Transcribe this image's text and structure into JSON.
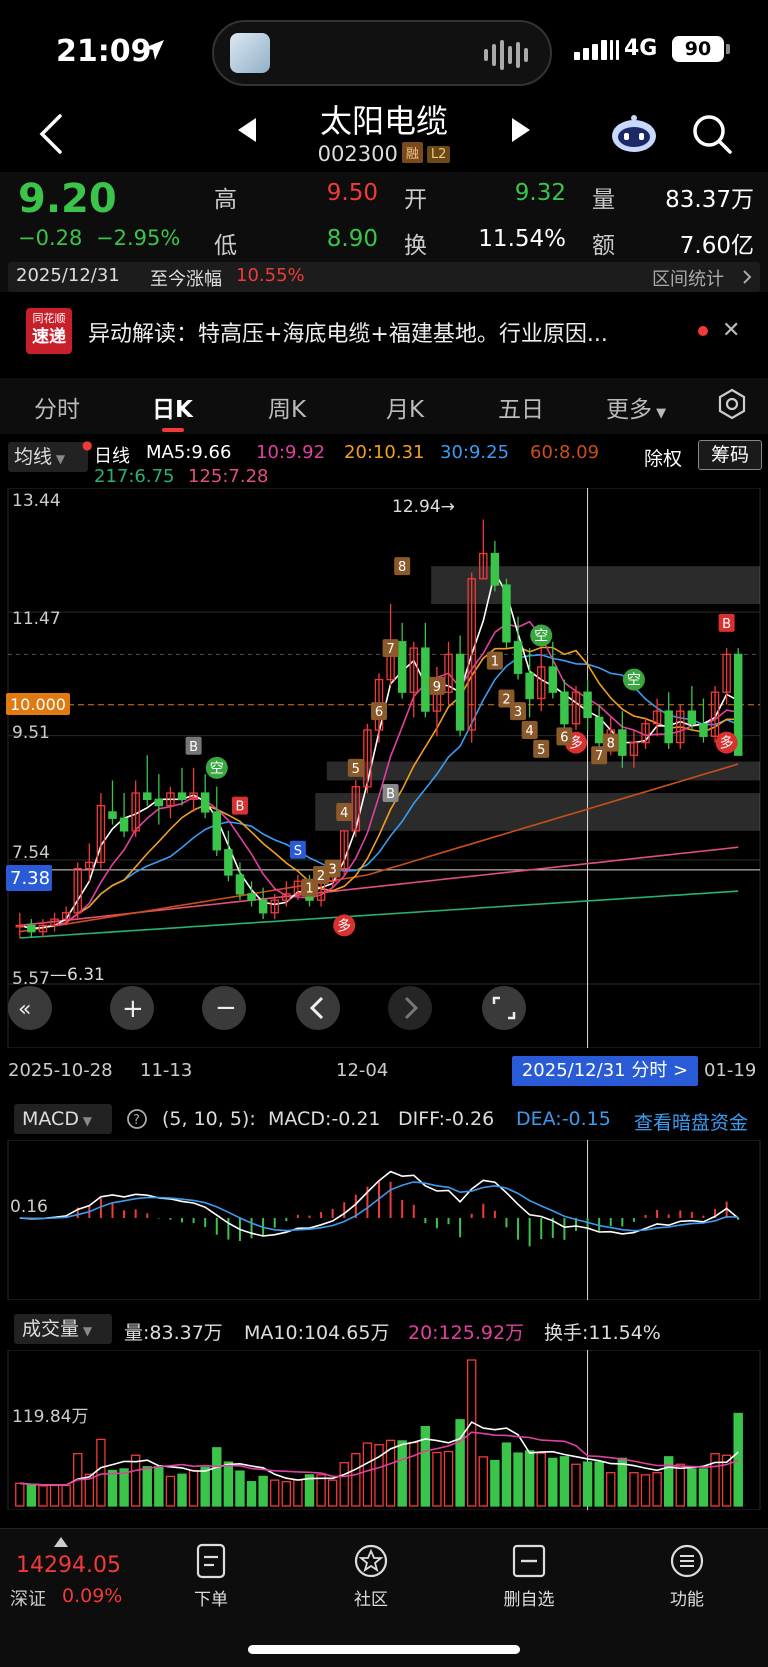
{
  "status": {
    "time": "21:09",
    "network": "4G",
    "battery": "90"
  },
  "header": {
    "name": "太阳电缆",
    "code": "002300",
    "tag_rong": "融",
    "tag_l2": "L2"
  },
  "quote": {
    "price": "9.20",
    "change": "−0.28",
    "change_pct": "−2.95%",
    "high_label": "高",
    "high": "9.50",
    "low_label": "低",
    "low": "8.90",
    "open_label": "开",
    "open": "9.32",
    "turnover_label": "换",
    "turnover": "11.54%",
    "volume_label": "量",
    "volume": "83.37万",
    "amount_label": "额",
    "amount": "7.60亿",
    "date": "2025/12/31",
    "since_label": "至今涨幅",
    "since_value": "10.55%",
    "range_stats": "区间统计"
  },
  "news": {
    "logo_top": "同花顺",
    "logo_bottom": "速递",
    "text": "异动解读：特高压+海底电缆+福建基地。行业原因..."
  },
  "tabs": {
    "t1": "分时",
    "t2": "日K",
    "t3": "周K",
    "t4": "月K",
    "t5": "五日",
    "t6": "更多"
  },
  "ma": {
    "selector": "均线",
    "daily": "日线",
    "ma5": "MA5:9.66",
    "ma10": "10:9.92",
    "ma20": "20:10.31",
    "ma30": "30:9.25",
    "ma60": "60:8.09",
    "ma217": "217:6.75",
    "ma125": "125:7.28",
    "chuquan": "除权",
    "chouma": "筹码",
    "colors": {
      "ma5": "#ffffff",
      "ma10": "#e040a0",
      "ma20": "#f0a020",
      "ma30": "#3a9cf0",
      "ma60": "#c85018",
      "ma217": "#2ab070",
      "ma125": "#e0507a"
    }
  },
  "kline_labels": {
    "y_13_44": "13.44",
    "y_11_47": "11.47",
    "y_10": "10.000",
    "y_9_51": "9.51",
    "y_7_54": "7.54",
    "y_7_38": "7.38",
    "y_5_57": "5.57",
    "low_mark": "6.31",
    "high_mark": "12.94→"
  },
  "xaxis": {
    "d1": "2025-10-28",
    "d2": "11-13",
    "d3": "12-04",
    "fenshi": "2025/12/31 分时 >",
    "d4": "01-19"
  },
  "macd": {
    "selector": "MACD",
    "params": "(5, 10, 5):",
    "macd": "MACD:-0.21",
    "diff": "DIFF:-0.26",
    "dea": "DEA:-0.15",
    "dark": "查看暗盘资金",
    "level": "0.16"
  },
  "volume": {
    "selector": "成交量",
    "vol": "量:83.37万",
    "ma10": "MA10:104.65万",
    "ma20": "20:125.92万",
    "turnover": "换手:11.54%",
    "level": "119.84万"
  },
  "bottom": {
    "index_value": "14294.05",
    "index_name": "深证",
    "index_pct": "0.09%",
    "b1": "下单",
    "b2": "社区",
    "b3": "删自选",
    "b4": "功能"
  },
  "chart_data": {
    "type": "candlestick",
    "ylim": [
      5.57,
      13.44
    ],
    "y_ticks": [
      13.44,
      11.47,
      9.51,
      7.54,
      5.57
    ],
    "x_ticks": [
      "2025-10-28",
      "11-13",
      "12-04",
      "01-19"
    ],
    "candles": [
      [
        6.5,
        6.7,
        6.3,
        6.5
      ],
      [
        6.5,
        6.6,
        6.3,
        6.4
      ],
      [
        6.4,
        6.6,
        6.31,
        6.5
      ],
      [
        6.5,
        6.7,
        6.4,
        6.6
      ],
      [
        6.6,
        6.8,
        6.5,
        6.7
      ],
      [
        6.7,
        7.5,
        6.6,
        7.4
      ],
      [
        7.4,
        7.8,
        7.2,
        7.5
      ],
      [
        7.5,
        8.6,
        7.4,
        8.4
      ],
      [
        8.3,
        8.8,
        8.1,
        8.2
      ],
      [
        8.2,
        8.6,
        7.9,
        8.0
      ],
      [
        8.0,
        8.8,
        7.9,
        8.6
      ],
      [
        8.6,
        9.2,
        8.4,
        8.5
      ],
      [
        8.5,
        8.9,
        8.1,
        8.4
      ],
      [
        8.4,
        8.7,
        8.2,
        8.6
      ],
      [
        8.6,
        9.0,
        8.4,
        8.5
      ],
      [
        8.5,
        9.0,
        8.3,
        8.6
      ],
      [
        8.6,
        8.9,
        8.2,
        8.3
      ],
      [
        8.3,
        8.7,
        7.6,
        7.7
      ],
      [
        7.7,
        8.0,
        7.2,
        7.3
      ],
      [
        7.3,
        7.5,
        6.9,
        7.0
      ],
      [
        7.0,
        7.2,
        6.8,
        6.9
      ],
      [
        6.9,
        7.1,
        6.6,
        6.7
      ],
      [
        6.7,
        7.0,
        6.6,
        6.9
      ],
      [
        6.9,
        7.2,
        6.8,
        7.0
      ],
      [
        7.0,
        7.3,
        6.9,
        7.2
      ],
      [
        7.2,
        7.3,
        6.8,
        6.9
      ],
      [
        6.9,
        7.3,
        6.8,
        7.2
      ],
      [
        7.2,
        7.5,
        7.1,
        7.4
      ],
      [
        7.4,
        8.0,
        7.3,
        8.0
      ],
      [
        8.0,
        8.8,
        7.9,
        8.7
      ],
      [
        8.7,
        9.7,
        8.6,
        9.6
      ],
      [
        9.6,
        10.5,
        9.4,
        10.4
      ],
      [
        10.4,
        11.6,
        10.3,
        11.0
      ],
      [
        11.0,
        11.3,
        10.1,
        10.2
      ],
      [
        10.2,
        11.0,
        9.8,
        10.9
      ],
      [
        10.9,
        11.3,
        9.8,
        9.9
      ],
      [
        9.9,
        10.6,
        9.5,
        10.2
      ],
      [
        10.2,
        11.0,
        10.0,
        10.8
      ],
      [
        10.8,
        11.1,
        9.5,
        9.6
      ],
      [
        9.6,
        12.1,
        9.4,
        12.0
      ],
      [
        12.0,
        12.94,
        12.0,
        12.4
      ],
      [
        12.4,
        12.6,
        11.8,
        11.9
      ],
      [
        11.9,
        12.0,
        10.9,
        11.0
      ],
      [
        11.0,
        11.4,
        10.4,
        10.5
      ],
      [
        10.5,
        10.9,
        9.8,
        10.1
      ],
      [
        10.1,
        10.9,
        9.9,
        10.6
      ],
      [
        10.6,
        11.0,
        10.1,
        10.2
      ],
      [
        10.2,
        10.4,
        9.5,
        9.7
      ],
      [
        9.7,
        10.3,
        9.6,
        10.2
      ],
      [
        10.2,
        10.4,
        9.6,
        9.8
      ],
      [
        9.8,
        10.0,
        9.2,
        9.4
      ],
      [
        9.4,
        9.8,
        9.2,
        9.6
      ],
      [
        9.6,
        9.9,
        9.0,
        9.2
      ],
      [
        9.2,
        9.6,
        9.0,
        9.4
      ],
      [
        9.4,
        9.8,
        9.3,
        9.7
      ],
      [
        9.7,
        10.1,
        9.5,
        9.9
      ],
      [
        9.9,
        10.2,
        9.3,
        9.4
      ],
      [
        9.4,
        10.0,
        9.3,
        9.9
      ],
      [
        9.9,
        10.3,
        9.6,
        9.7
      ],
      [
        9.7,
        10.1,
        9.4,
        9.5
      ],
      [
        9.5,
        10.3,
        9.4,
        10.2
      ],
      [
        10.2,
        10.9,
        10.0,
        10.8
      ],
      [
        10.8,
        10.9,
        9.3,
        9.2
      ]
    ]
  }
}
